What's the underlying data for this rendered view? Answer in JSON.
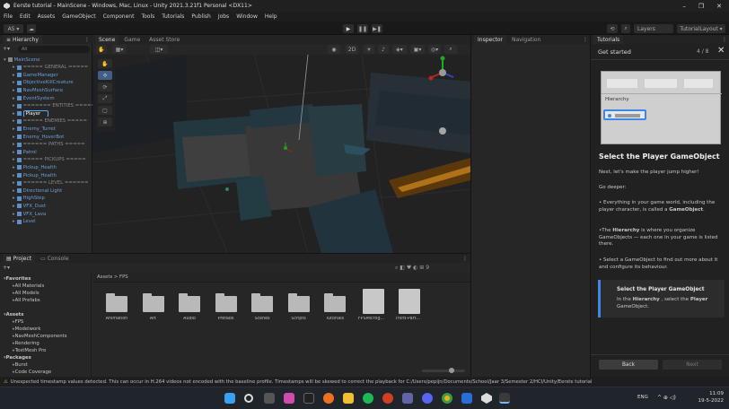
{
  "window": {
    "title": "Eerste tutorial - MainScene - Windows, Mac, Linux - Unity 2021.3.21f1 Personal <DX11>",
    "min": "–",
    "max": "❐",
    "close": "✕"
  },
  "menu": [
    "File",
    "Edit",
    "Assets",
    "GameObject",
    "Component",
    "Tools",
    "Tutorials",
    "Publish",
    "Jobs",
    "Window",
    "Help"
  ],
  "toolbar": {
    "account": "AS ▾",
    "layers": "Layers",
    "layout": "TutorialLayout ▾",
    "play": "▶",
    "pause": "❚❚",
    "step": "▶❚"
  },
  "hierarchy": {
    "tab": "Hierarchy",
    "search_placeholder": "All",
    "items": [
      {
        "label": "MainScene",
        "indent": 0,
        "icon": "scene"
      },
      {
        "label": "===== GENERAL =====",
        "indent": 1,
        "icon": "go"
      },
      {
        "label": "GameManager",
        "indent": 1,
        "icon": "go"
      },
      {
        "label": "ObjectiveKillCreature",
        "indent": 1,
        "icon": "go"
      },
      {
        "label": "NavMeshSurface",
        "indent": 1,
        "icon": "go"
      },
      {
        "label": "EventSystem",
        "indent": 1,
        "icon": "go"
      },
      {
        "label": "======= ENTITIES ======",
        "indent": 1,
        "icon": "go"
      },
      {
        "label": "Player",
        "indent": 1,
        "icon": "go",
        "highlight": true
      },
      {
        "label": "===== ENEMIES =====",
        "indent": 1,
        "icon": "go"
      },
      {
        "label": "Enemy_Turret",
        "indent": 1,
        "icon": "go"
      },
      {
        "label": "Enemy_HoverBot",
        "indent": 1,
        "icon": "go"
      },
      {
        "label": "====== PATHS =====",
        "indent": 1,
        "icon": "go"
      },
      {
        "label": "Patrol",
        "indent": 1,
        "icon": "go"
      },
      {
        "label": "===== PICKUPS =====",
        "indent": 1,
        "icon": "go"
      },
      {
        "label": "Pickup_Health",
        "indent": 1,
        "icon": "go"
      },
      {
        "label": "Pickup_Health",
        "indent": 1,
        "icon": "go"
      },
      {
        "label": "====== LEVEL ======",
        "indent": 1,
        "icon": "go"
      },
      {
        "label": "Directional Light",
        "indent": 1,
        "icon": "go"
      },
      {
        "label": "HighStep",
        "indent": 1,
        "icon": "go"
      },
      {
        "label": "VFX_Dust",
        "indent": 1,
        "icon": "go"
      },
      {
        "label": "VFX_Lava",
        "indent": 1,
        "icon": "go"
      },
      {
        "label": "Level",
        "indent": 1,
        "icon": "go"
      }
    ]
  },
  "scene": {
    "tabs": [
      "Scene",
      "Game",
      "Asset Store"
    ]
  },
  "inspector": {
    "tabs": [
      "Inspector",
      "Navigation"
    ]
  },
  "tutorials": {
    "tab": "Tutorials",
    "section": "Get started",
    "progress": "4 / 8",
    "preview_label": "Hierarchy",
    "heading": "Select the Player GameObject",
    "intro": "Next, let's make the player jump higher!",
    "deeper": "Go deeper:",
    "bullet1_pre": "• Everything in your game world, including the player character, is called a ",
    "bullet1_bold": "GameObject",
    "bullet1_post": ".",
    "bullet2_pre": "•The ",
    "bullet2_bold": "Hierarchy",
    "bullet2_post": " is where you organize GameObjects — each one in your game is listed there.",
    "bullet3": "• Select a GameObject to find out more about it and configure its behaviour.",
    "task_title": "Select the Player GameObject",
    "task_pre": "In the ",
    "task_b1": "Hierarchy",
    "task_mid": " , select the ",
    "task_b2": "Player",
    "task_post": " GameObject.",
    "back": "Back",
    "next": "Next"
  },
  "project": {
    "tabs": [
      "Project",
      "Console"
    ],
    "breadcrumb": "Assets > FPS",
    "tree": [
      {
        "label": "Favorites",
        "indent": 0,
        "bold": true
      },
      {
        "label": "All Materials",
        "indent": 1
      },
      {
        "label": "All Models",
        "indent": 1
      },
      {
        "label": "All Prefabs",
        "indent": 1
      },
      {
        "label": "",
        "indent": 0
      },
      {
        "label": "Assets",
        "indent": 0,
        "bold": true
      },
      {
        "label": "FPS",
        "indent": 1
      },
      {
        "label": "Modelwork",
        "indent": 1
      },
      {
        "label": "NavMeshComponents",
        "indent": 1
      },
      {
        "label": "Rendering",
        "indent": 1
      },
      {
        "label": "TextMesh Pro",
        "indent": 1
      },
      {
        "label": "Packages",
        "indent": 0,
        "bold": true
      },
      {
        "label": "Burst",
        "indent": 1
      },
      {
        "label": "Code Coverage",
        "indent": 1
      }
    ],
    "assets": [
      "Animation",
      "Art",
      "Audio",
      "Prefabs",
      "Scenes",
      "Scripts",
      "Tutorials",
      "FPSMicrog...",
      "Third-Part..."
    ]
  },
  "console_message": "Unexpected timestamp values detected. This can occur in H.264 videos not encoded with the baseline profile. Timestamps will be skewed to correct the playback for C:/Users/pepijn/Documents/School/Jaar 3/Semester 2/HCI/Unity/Eerste tutorial",
  "taskbar": {
    "time": "11:09",
    "date": "19-5-2022",
    "lang": "ENG",
    "tray": "^ ⊕ ◁)"
  }
}
